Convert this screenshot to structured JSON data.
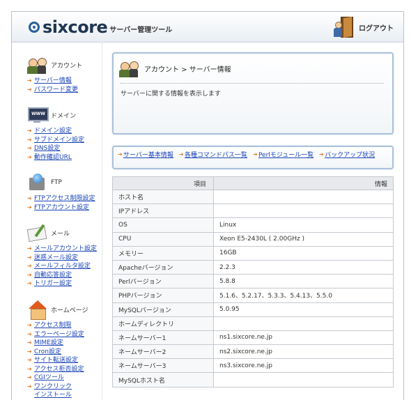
{
  "header": {
    "logo_text": "sixcore",
    "logo_sub": "サーバー管理ツール",
    "logout_label": "ログアウト"
  },
  "sidebar": {
    "groups": [
      {
        "title": "アカウント",
        "icon": "account-icon",
        "items": [
          "サーバー情報",
          "パスワード変更"
        ]
      },
      {
        "title": "ドメイン",
        "icon": "domain-www-icon",
        "items": [
          "ドメイン設定",
          "サブドメイン設定",
          "DNS設定",
          "動作確認URL"
        ]
      },
      {
        "title": "FTP",
        "icon": "ftp-globe-icon",
        "items": [
          "FTPアクセス制限設定",
          "FTPアカウント設定"
        ]
      },
      {
        "title": "メール",
        "icon": "mail-icon",
        "items": [
          "メールアカウント設定",
          "迷惑メール設定",
          "メールフィルタ設定",
          "自動応答設定",
          "トリガー設定"
        ]
      },
      {
        "title": "ホームページ",
        "icon": "home-icon",
        "items": [
          "アクセス制限",
          "エラーページ設定",
          "MIME設定",
          "Cron設定",
          "サイト転送設定",
          "アクセス拒否設定",
          "CGIツール",
          "ワンクリック",
          "インストール"
        ]
      }
    ]
  },
  "main": {
    "breadcrumb": "アカウント > サーバー情報",
    "description": "サーバーに関する情報を表示します",
    "tabs": [
      "サーバー基本情報",
      "各種コマンドパス一覧",
      "Perlモジュール一覧",
      "バックアップ状況"
    ],
    "table": {
      "headers": [
        "項目",
        "情報"
      ],
      "rows": [
        [
          "ホスト名",
          ""
        ],
        [
          "IPアドレス",
          ""
        ],
        [
          "OS",
          "Linux"
        ],
        [
          "CPU",
          "Xeon E5-2430L ( 2.00GHz )"
        ],
        [
          "メモリー",
          "16GB"
        ],
        [
          "Apacheバージョン",
          "2.2.3"
        ],
        [
          "Perlバージョン",
          "5.8.8"
        ],
        [
          "PHPバージョン",
          "5.1.6、5.2.17、5.3.3、5.4.13、5.5.0"
        ],
        [
          "MySQLバージョン",
          "5.0.95"
        ],
        [
          "ホームディレクトリ",
          ""
        ],
        [
          "ネームサーバー1",
          "ns1.sixcore.ne.jp"
        ],
        [
          "ネームサーバー2",
          "ns2.sixcore.ne.jp"
        ],
        [
          "ネームサーバー3",
          "ns3.sixcore.ne.jp"
        ],
        [
          "MySQLホスト名",
          ""
        ]
      ]
    }
  }
}
